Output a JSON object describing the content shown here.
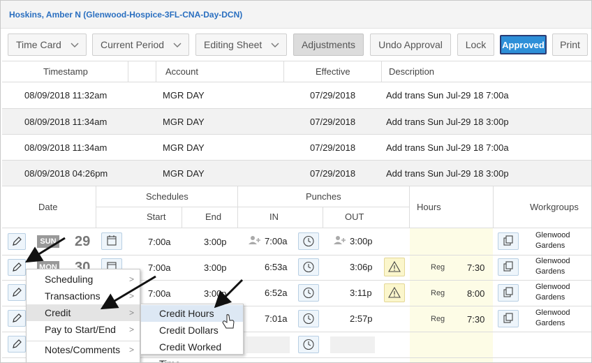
{
  "header": {
    "employee": "Hoskins, Amber N (Glenwood-Hospice-3FL-CNA-Day-DCN)"
  },
  "toolbar": {
    "time_card": "Time Card",
    "current_period": "Current Period",
    "editing_sheet": "Editing Sheet",
    "adjustments": "Adjustments",
    "undo_approval": "Undo Approval",
    "lock": "Lock",
    "approved": "Approved",
    "print": "Print"
  },
  "adjust_table": {
    "headers": {
      "timestamp": "Timestamp",
      "account": "Account",
      "effective": "Effective",
      "description": "Description"
    },
    "rows": [
      {
        "timestamp": "08/09/2018 11:32am",
        "account": "MGR DAY",
        "effective": "07/29/2018",
        "description": "Add trans Sun Jul-29 18 7:00a"
      },
      {
        "timestamp": "08/09/2018 11:34am",
        "account": "MGR DAY",
        "effective": "07/29/2018",
        "description": "Add trans Sun Jul-29 18 3:00p"
      },
      {
        "timestamp": "08/09/2018 11:34am",
        "account": "MGR DAY",
        "effective": "07/29/2018",
        "description": "Add trans Sun Jul-29 18 7:00a"
      },
      {
        "timestamp": "08/09/2018 04:26pm",
        "account": "MGR DAY",
        "effective": "07/29/2018",
        "description": "Add trans Sun Jul-29 18 3:00p"
      }
    ]
  },
  "timecard": {
    "headers": {
      "date": "Date",
      "schedules": "Schedules",
      "start": "Start",
      "end": "End",
      "punches": "Punches",
      "in": "IN",
      "out": "OUT",
      "hours": "Hours",
      "workgroups": "Workgroups"
    },
    "rows": [
      {
        "day": "SUN",
        "daynum": "29",
        "start": "7:00a",
        "end": "3:00p",
        "in": "7:00a",
        "out": "3:00p",
        "pay": "",
        "hours": "",
        "wg1": "Glenwood",
        "wg2": "Gardens"
      },
      {
        "day": "MON",
        "daynum": "30",
        "start": "7:00a",
        "end": "3:00p",
        "in": "6:53a",
        "out": "3:06p",
        "pay": "Reg",
        "hours": "7:30",
        "wg1": "Glenwood",
        "wg2": "Gardens"
      },
      {
        "day": "",
        "daynum": "",
        "start": "7:00a",
        "end": "3:00p",
        "in": "6:52a",
        "out": "3:11p",
        "pay": "Reg",
        "hours": "8:00",
        "wg1": "Glenwood",
        "wg2": "Gardens"
      },
      {
        "day": "",
        "daynum": "",
        "start": "",
        "end": "",
        "in": "7:01a",
        "out": "2:57p",
        "pay": "Reg",
        "hours": "7:30",
        "wg1": "Glenwood",
        "wg2": "Gardens"
      }
    ]
  },
  "context_menu": {
    "items": [
      "Scheduling",
      "Transactions",
      "Credit",
      "Pay to Start/End",
      "Notes/Comments"
    ],
    "submenu": [
      "Credit Hours",
      "Credit Dollars",
      "Credit Worked Time"
    ]
  }
}
